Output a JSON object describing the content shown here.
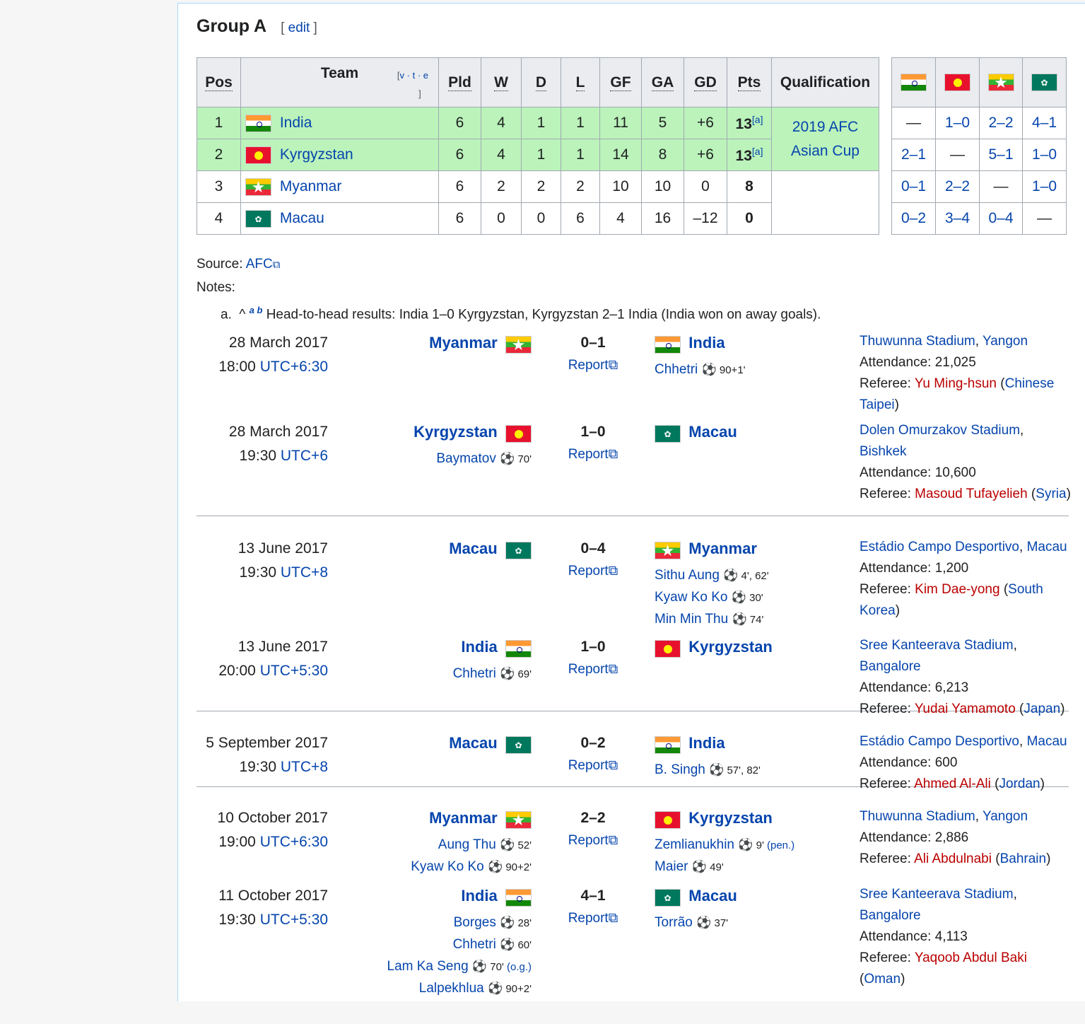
{
  "group": {
    "title": "Group A",
    "edit_label": "edit"
  },
  "table": {
    "headers": {
      "pos": "Pos",
      "team": "Team",
      "vte": "v · t · e",
      "pld": "Pld",
      "w": "W",
      "d": "D",
      "l": "L",
      "gf": "GF",
      "ga": "GA",
      "gd": "GD",
      "pts": "Pts",
      "qual": "Qualification"
    },
    "qualification": "2019 AFC Asian Cup",
    "rows": [
      {
        "pos": "1",
        "team": "India",
        "flag": "india",
        "pld": "6",
        "w": "4",
        "d": "1",
        "l": "1",
        "gf": "11",
        "ga": "5",
        "gd": "+6",
        "pts": "13",
        "note": "[a]",
        "res": [
          "—",
          "1–0",
          "2–2",
          "4–1"
        ]
      },
      {
        "pos": "2",
        "team": "Kyrgyzstan",
        "flag": "kgz",
        "pld": "6",
        "w": "4",
        "d": "1",
        "l": "1",
        "gf": "14",
        "ga": "8",
        "gd": "+6",
        "pts": "13",
        "note": "[a]",
        "res": [
          "2–1",
          "—",
          "5–1",
          "1–0"
        ]
      },
      {
        "pos": "3",
        "team": "Myanmar",
        "flag": "mya",
        "pld": "6",
        "w": "2",
        "d": "2",
        "l": "2",
        "gf": "10",
        "ga": "10",
        "gd": "0",
        "pts": "8",
        "note": "",
        "res": [
          "0–1",
          "2–2",
          "—",
          "1–0"
        ]
      },
      {
        "pos": "4",
        "team": "Macau",
        "flag": "mac",
        "pld": "6",
        "w": "0",
        "d": "0",
        "l": "6",
        "gf": "4",
        "ga": "16",
        "gd": "–12",
        "pts": "0",
        "note": "",
        "res": [
          "0–2",
          "3–4",
          "0–4",
          "—"
        ]
      }
    ]
  },
  "source": {
    "label": "Source:",
    "link": "AFC"
  },
  "notes": {
    "label": "Notes:",
    "marker": "a.",
    "caret": "^",
    "refs": "a b",
    "text": "Head-to-head results: India 1–0 Kyrgyzstan, Kyrgyzstan 2–1 India (India won on away goals)."
  },
  "report_label": "Report",
  "matches": [
    {
      "date": "28 March 2017",
      "time": "18:00",
      "tz": "UTC+6:30",
      "home": "Myanmar",
      "home_flag": "mya",
      "score": "0–1",
      "away": "India",
      "away_flag": "india",
      "home_scorers": [],
      "away_scorers": [
        {
          "name": "Chhetri",
          "min": "90+1'"
        }
      ],
      "venue": "Thuwunna Stadium",
      "city": "Yangon",
      "attendance": "Attendance: 21,025",
      "referee": "Yu Ming-hsun",
      "ref_country": "Chinese Taipei"
    },
    {
      "date": "28 March 2017",
      "time": "19:30",
      "tz": "UTC+6",
      "home": "Kyrgyzstan",
      "home_flag": "kgz",
      "score": "1–0",
      "away": "Macau",
      "away_flag": "mac",
      "home_scorers": [
        {
          "name": "Baymatov",
          "min": "70'"
        }
      ],
      "away_scorers": [],
      "venue": "Dolen Omurzakov Stadium",
      "city": "Bishkek",
      "attendance": "Attendance: 10,600",
      "referee": "Masoud Tufayelieh",
      "ref_country": "Syria"
    },
    {
      "date": "13 June 2017",
      "time": "19:30",
      "tz": "UTC+8",
      "home": "Macau",
      "home_flag": "mac",
      "score": "0–4",
      "away": "Myanmar",
      "away_flag": "mya",
      "home_scorers": [],
      "away_scorers": [
        {
          "name": "Sithu Aung",
          "min": "4', 62'"
        },
        {
          "name": "Kyaw Ko Ko",
          "min": "30'"
        },
        {
          "name": "Min Min Thu",
          "min": "74'"
        }
      ],
      "venue": "Estádio Campo Desportivo",
      "city": "Macau",
      "attendance": "Attendance: 1,200",
      "referee": "Kim Dae-yong",
      "ref_country": "South Korea"
    },
    {
      "date": "13 June 2017",
      "time": "20:00",
      "tz": "UTC+5:30",
      "home": "India",
      "home_flag": "india",
      "score": "1–0",
      "away": "Kyrgyzstan",
      "away_flag": "kgz",
      "home_scorers": [
        {
          "name": "Chhetri",
          "min": "69'"
        }
      ],
      "away_scorers": [],
      "venue": "Sree Kanteerava Stadium",
      "city": "Bangalore",
      "attendance": "Attendance: 6,213",
      "referee": "Yudai Yamamoto",
      "ref_country": "Japan"
    },
    {
      "date": "5 September 2017",
      "time": "19:30",
      "tz": "UTC+8",
      "home": "Macau",
      "home_flag": "mac",
      "score": "0–2",
      "away": "India",
      "away_flag": "india",
      "home_scorers": [],
      "away_scorers": [
        {
          "name": "B. Singh",
          "min": "57', 82'"
        }
      ],
      "venue": "Estádio Campo Desportivo",
      "city": "Macau",
      "attendance": "Attendance: 600",
      "referee": "Ahmed Al-Ali",
      "ref_country": "Jordan"
    },
    {
      "date": "10 October 2017",
      "time": "19:00",
      "tz": "UTC+6:30",
      "home": "Myanmar",
      "home_flag": "mya",
      "score": "2–2",
      "away": "Kyrgyzstan",
      "away_flag": "kgz",
      "home_scorers": [
        {
          "name": "Aung Thu",
          "min": "52'"
        },
        {
          "name": "Kyaw Ko Ko",
          "min": "90+2'"
        }
      ],
      "away_scorers": [
        {
          "name": "Zemlianukhin",
          "min": "9'",
          "extra": "(pen.)"
        },
        {
          "name": "Maier",
          "min": "49'"
        }
      ],
      "venue": "Thuwunna Stadium",
      "city": "Yangon",
      "attendance": "Attendance: 2,886",
      "referee": "Ali Abdulnabi",
      "ref_country": "Bahrain"
    },
    {
      "date": "11 October 2017",
      "time": "19:30",
      "tz": "UTC+5:30",
      "home": "India",
      "home_flag": "india",
      "score": "4–1",
      "away": "Macau",
      "away_flag": "mac",
      "home_scorers": [
        {
          "name": "Borges",
          "min": "28'"
        },
        {
          "name": "Chhetri",
          "min": "60'"
        },
        {
          "name": "Lam Ka Seng",
          "min": "70'",
          "extra": "(o.g.)"
        },
        {
          "name": "Lalpekhlua",
          "min": "90+2'"
        }
      ],
      "away_scorers": [
        {
          "name": "Torrão",
          "min": "37'"
        }
      ],
      "venue": "Sree Kanteerava Stadium",
      "city": "Bangalore",
      "attendance": "Attendance: 4,113",
      "referee": "Yaqoob Abdul Baki",
      "ref_country": "Oman"
    }
  ]
}
